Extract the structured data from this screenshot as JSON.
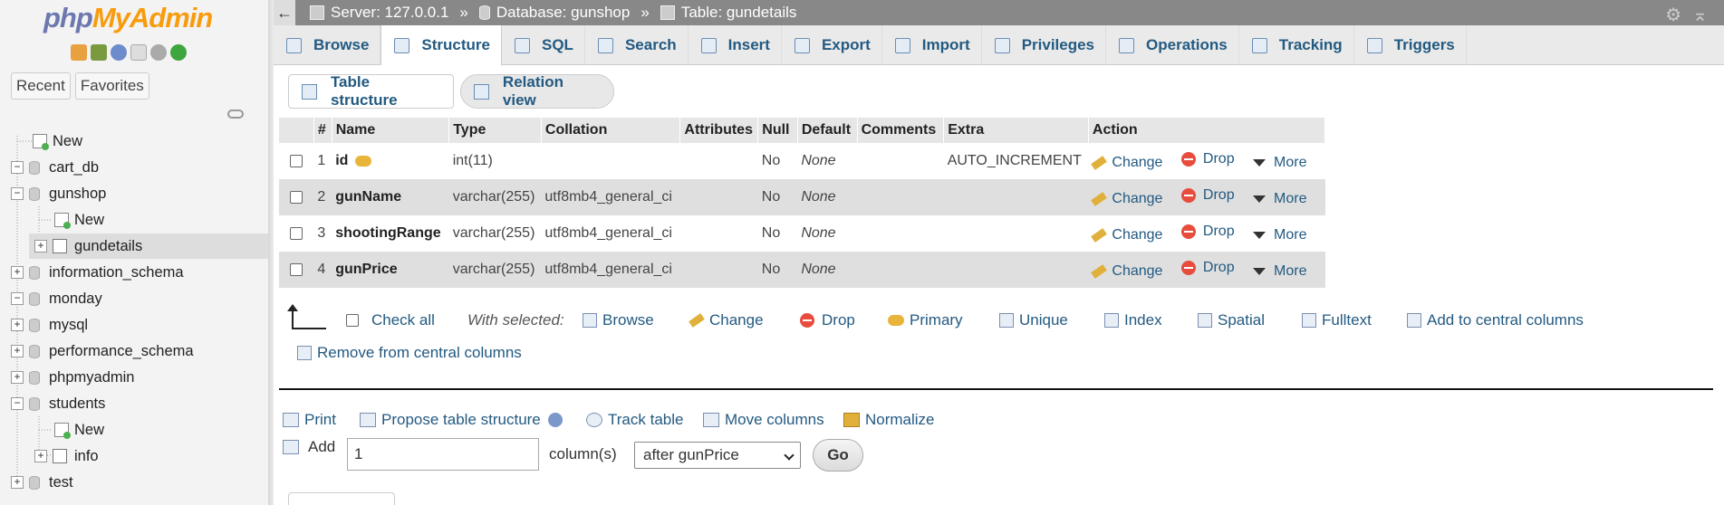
{
  "nav": {
    "logo_php": "php",
    "logo_myadmin": "MyAdmin",
    "tabs": [
      "Recent",
      "Favorites"
    ],
    "tree": [
      {
        "label": "New"
      },
      {
        "label": "cart_db"
      },
      {
        "label": "gunshop"
      },
      {
        "label": "New"
      },
      {
        "label": "gundetails"
      },
      {
        "label": "information_schema"
      },
      {
        "label": "monday"
      },
      {
        "label": "mysql"
      },
      {
        "label": "performance_schema"
      },
      {
        "label": "phpmyadmin"
      },
      {
        "label": "students"
      },
      {
        "label": "New"
      },
      {
        "label": "info"
      },
      {
        "label": "test"
      }
    ]
  },
  "breadcrumb": {
    "server": "Server: 127.0.0.1",
    "database": "Database: gunshop",
    "table": "Table: gundetails",
    "sep": "»"
  },
  "tabs": [
    "Browse",
    "Structure",
    "SQL",
    "Search",
    "Insert",
    "Export",
    "Import",
    "Privileges",
    "Operations",
    "Tracking",
    "Triggers"
  ],
  "subtabs": [
    "Table structure",
    "Relation view"
  ],
  "table": {
    "headers": [
      "#",
      "Name",
      "Type",
      "Collation",
      "Attributes",
      "Null",
      "Default",
      "Comments",
      "Extra",
      "Action"
    ],
    "rows": [
      {
        "num": "1",
        "name": "id",
        "type": "int(11)",
        "collation": "",
        "attributes": "",
        "null": "No",
        "default": "None",
        "comments": "",
        "extra": "AUTO_INCREMENT"
      },
      {
        "num": "2",
        "name": "gunName",
        "type": "varchar(255)",
        "collation": "utf8mb4_general_ci",
        "attributes": "",
        "null": "No",
        "default": "None",
        "comments": "",
        "extra": ""
      },
      {
        "num": "3",
        "name": "shootingRange",
        "type": "varchar(255)",
        "collation": "utf8mb4_general_ci",
        "attributes": "",
        "null": "No",
        "default": "None",
        "comments": "",
        "extra": ""
      },
      {
        "num": "4",
        "name": "gunPrice",
        "type": "varchar(255)",
        "collation": "utf8mb4_general_ci",
        "attributes": "",
        "null": "No",
        "default": "None",
        "comments": "",
        "extra": ""
      }
    ],
    "actions": {
      "change": "Change",
      "drop": "Drop",
      "more": "More"
    }
  },
  "with_selected": {
    "check_all": "Check all",
    "label": "With selected:",
    "items": [
      "Browse",
      "Change",
      "Drop",
      "Primary",
      "Unique",
      "Index",
      "Spatial",
      "Fulltext",
      "Add to central columns"
    ],
    "remove": "Remove from central columns"
  },
  "bottom": {
    "print": "Print",
    "propose": "Propose table structure",
    "track": "Track table",
    "move": "Move columns",
    "normalize": "Normalize",
    "add_label": "Add",
    "add_value": "1",
    "columns_label": "column(s)",
    "position_value": "after gunPrice",
    "go": "Go"
  }
}
